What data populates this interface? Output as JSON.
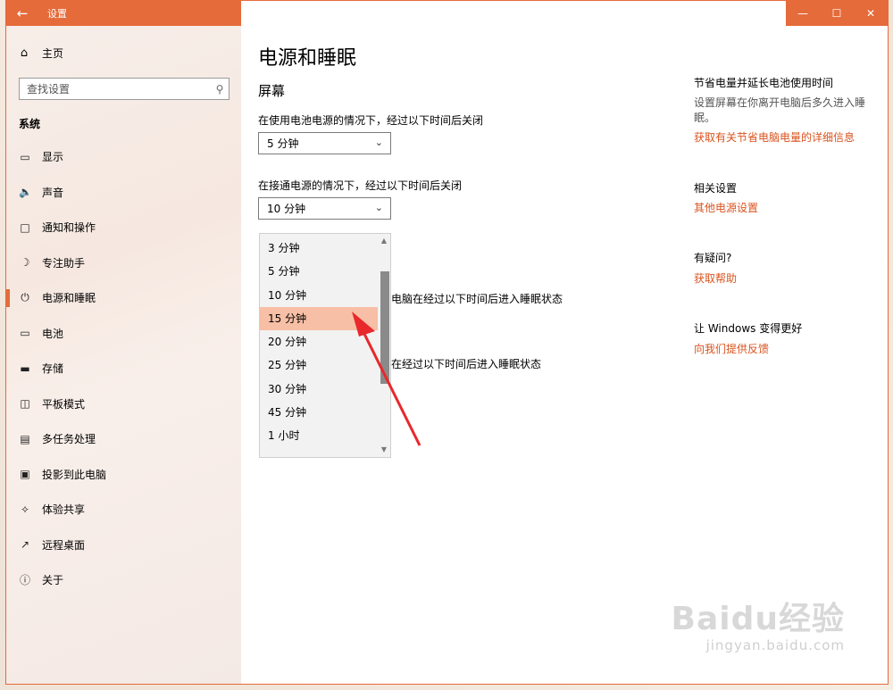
{
  "window": {
    "app_title": "设置",
    "back_icon": "arrow-left-icon",
    "controls": [
      "minimize-icon",
      "maximize-icon",
      "close-icon"
    ],
    "accent_color": "#e56b3a"
  },
  "sidebar": {
    "home_label": "主页",
    "search_placeholder": "查找设置",
    "section_label": "系统",
    "items": [
      {
        "label": "显示",
        "icon": "monitor-icon"
      },
      {
        "label": "声音",
        "icon": "speaker-icon"
      },
      {
        "label": "通知和操作",
        "icon": "notification-icon"
      },
      {
        "label": "专注助手",
        "icon": "moon-icon"
      },
      {
        "label": "电源和睡眠",
        "icon": "power-icon",
        "active": true
      },
      {
        "label": "电池",
        "icon": "battery-icon"
      },
      {
        "label": "存储",
        "icon": "storage-icon"
      },
      {
        "label": "平板模式",
        "icon": "tablet-icon"
      },
      {
        "label": "多任务处理",
        "icon": "multitask-icon"
      },
      {
        "label": "投影到此电脑",
        "icon": "project-icon"
      },
      {
        "label": "体验共享",
        "icon": "share-icon"
      },
      {
        "label": "远程桌面",
        "icon": "remote-icon"
      },
      {
        "label": "关于",
        "icon": "info-icon"
      }
    ]
  },
  "main": {
    "title": "电源和睡眠",
    "screen_section": "屏幕",
    "battery_label": "在使用电池电源的情况下，经过以下时间后关闭",
    "battery_value": "5 分钟",
    "plugged_label": "在接通电源的情况下，经过以下时间后关闭",
    "plugged_value": "10 分钟",
    "sleep_battery_fragment": "电脑在经过以下时间后进入睡眠状态",
    "sleep_plugged_fragment": "在经过以下时间后进入睡眠状态",
    "dropdown": {
      "options": [
        "3 分钟",
        "5 分钟",
        "10 分钟",
        "15 分钟",
        "20 分钟",
        "25 分钟",
        "30 分钟",
        "45 分钟",
        "1 小时"
      ],
      "selected_index": 3
    }
  },
  "right_pane": {
    "save_head": "节省电量并延长电池使用时间",
    "save_text": "设置屏幕在你离开电脑后多久进入睡眠。",
    "save_link": "获取有关节省电脑电量的详细信息",
    "related_head": "相关设置",
    "related_link": "其他电源设置",
    "question_head": "有疑问?",
    "question_link": "获取帮助",
    "improve_head": "让 Windows 变得更好",
    "improve_link": "向我们提供反馈"
  },
  "watermark": {
    "logo": "Baidu经验",
    "url": "jingyan.baidu.com"
  }
}
